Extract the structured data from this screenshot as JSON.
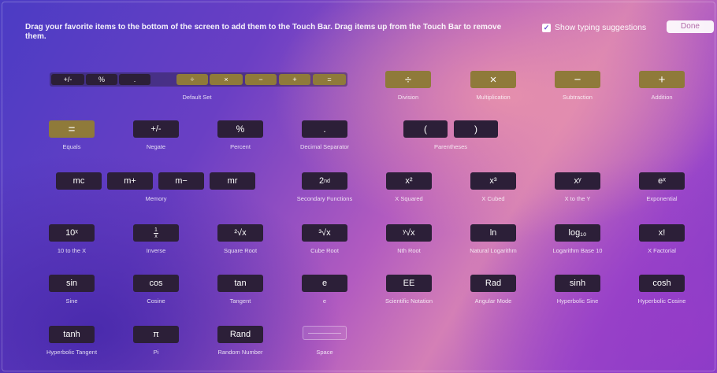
{
  "header": {
    "instructions": "Drag your favorite items to the bottom of the screen to add them to the Touch Bar. Drag items up from the Touch Bar to remove them.",
    "show_typing_suggestions": "Show typing suggestions",
    "show_typing_checked": true,
    "done": "Done"
  },
  "default_set": {
    "label": "Default Set",
    "keys": [
      "+/-",
      "%",
      ".",
      "÷",
      "×",
      "−",
      "+",
      "="
    ]
  },
  "items": {
    "division": {
      "key": "÷",
      "label": "Division"
    },
    "multiplication": {
      "key": "×",
      "label": "Multiplication"
    },
    "subtraction": {
      "key": "−",
      "label": "Subtraction"
    },
    "addition": {
      "key": "+",
      "label": "Addition"
    },
    "equals": {
      "key": "=",
      "label": "Equals"
    },
    "negate": {
      "key": "+/-",
      "label": "Negate"
    },
    "percent": {
      "key": "%",
      "label": "Percent"
    },
    "decimal": {
      "key": ".",
      "label": "Decimal Separator"
    },
    "parentheses": {
      "open": "(",
      "close": ")",
      "label": "Parentheses"
    },
    "memory": {
      "keys": [
        "mc",
        "m+",
        "m−",
        "mr"
      ],
      "label": "Memory"
    },
    "secondary": {
      "key": "2nd",
      "label": "Secondary Functions"
    },
    "x_squared": {
      "key": "x²",
      "label": "X Squared"
    },
    "x_cubed": {
      "key": "x³",
      "label": "X Cubed"
    },
    "x_to_y": {
      "key": "xʸ",
      "label": "X to the Y"
    },
    "exponential": {
      "key": "eˣ",
      "label": "Exponential"
    },
    "ten_to_x": {
      "key": "10ˣ",
      "label": "10 to the X"
    },
    "inverse": {
      "num": "1",
      "den": "x",
      "label": "Inverse"
    },
    "square_root": {
      "key": "²√x",
      "label": "Square Root"
    },
    "cube_root": {
      "key": "³√x",
      "label": "Cube Root"
    },
    "nth_root": {
      "key": "ʸ√x",
      "label": "Nth Root"
    },
    "natural_log": {
      "key": "ln",
      "label": "Natural Logarithm"
    },
    "log10": {
      "key": "log₁₀",
      "label": "Logarithm Base 10"
    },
    "factorial": {
      "key": "x!",
      "label": "X Factorial"
    },
    "sine": {
      "key": "sin",
      "label": "Sine"
    },
    "cosine": {
      "key": "cos",
      "label": "Cosine"
    },
    "tangent": {
      "key": "tan",
      "label": "Tangent"
    },
    "e": {
      "key": "e",
      "label": "e"
    },
    "scientific": {
      "key": "EE",
      "label": "Scientific Notation"
    },
    "angular": {
      "key": "Rad",
      "label": "Angular Mode"
    },
    "sinh": {
      "key": "sinh",
      "label": "Hyperbolic Sine"
    },
    "cosh": {
      "key": "cosh",
      "label": "Hyperbolic Cosine"
    },
    "tanh": {
      "key": "tanh",
      "label": "Hyperbolic Tangent"
    },
    "pi": {
      "key": "π",
      "label": "Pi"
    },
    "rand": {
      "key": "Rand",
      "label": "Random Number"
    },
    "space": {
      "label": "Space"
    }
  }
}
